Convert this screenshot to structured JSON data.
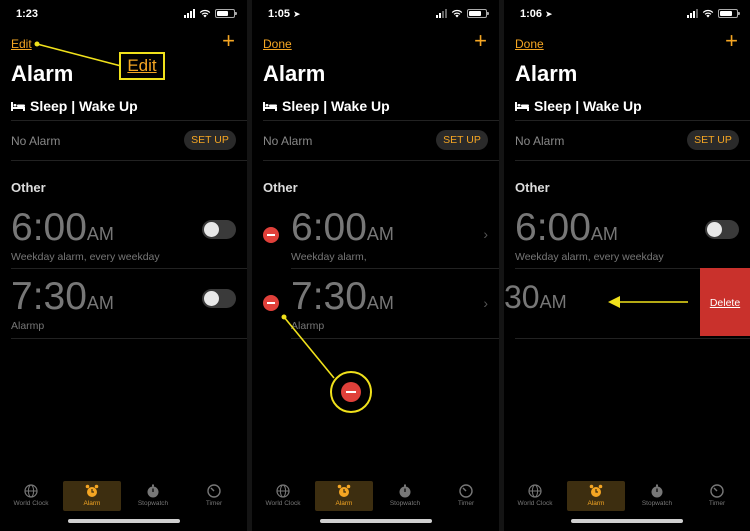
{
  "colors": {
    "accent": "#f5a623",
    "annotation": "#f0e11b",
    "delete": "#c9312c",
    "minus": "#e0403a"
  },
  "screens": [
    {
      "status_time": "1:23",
      "nav_left": "Edit",
      "nav_right": "+",
      "title": "Alarm",
      "sleep_label": "Sleep | Wake Up",
      "no_alarm": "No Alarm",
      "setup_label": "SET UP",
      "section": "Other",
      "alarms": [
        {
          "time": "6:00",
          "ampm": "AM",
          "label": "Weekday alarm, every weekday"
        },
        {
          "time": "7:30",
          "ampm": "AM",
          "label": "Alarmp"
        }
      ],
      "callout": "Edit"
    },
    {
      "status_time": "1:05",
      "nav_left": "Done",
      "nav_right": "+",
      "title": "Alarm",
      "sleep_label": "Sleep | Wake Up",
      "no_alarm": "No Alarm",
      "setup_label": "SET UP",
      "section": "Other",
      "alarms": [
        {
          "time": "6:00",
          "ampm": "AM",
          "label": "Weekday alarm,"
        },
        {
          "time": "7:30",
          "ampm": "AM",
          "label": "Alarmp"
        }
      ],
      "chevron": "›"
    },
    {
      "status_time": "1:06",
      "nav_left": "Done",
      "nav_right": "+",
      "title": "Alarm",
      "sleep_label": "Sleep | Wake Up",
      "no_alarm": "No Alarm",
      "setup_label": "SET UP",
      "section": "Other",
      "alarms": [
        {
          "time": "6:00",
          "ampm": "AM",
          "label": "Weekday alarm, every weekday"
        },
        {
          "time": "30",
          "ampm": "AM",
          "label": ""
        }
      ],
      "delete_label": "Delete"
    }
  ],
  "tabs": [
    {
      "label": "World Clock",
      "icon": "globe-icon"
    },
    {
      "label": "Alarm",
      "icon": "alarm-clock-icon",
      "active": true
    },
    {
      "label": "Stopwatch",
      "icon": "stopwatch-icon"
    },
    {
      "label": "Timer",
      "icon": "timer-icon"
    }
  ]
}
